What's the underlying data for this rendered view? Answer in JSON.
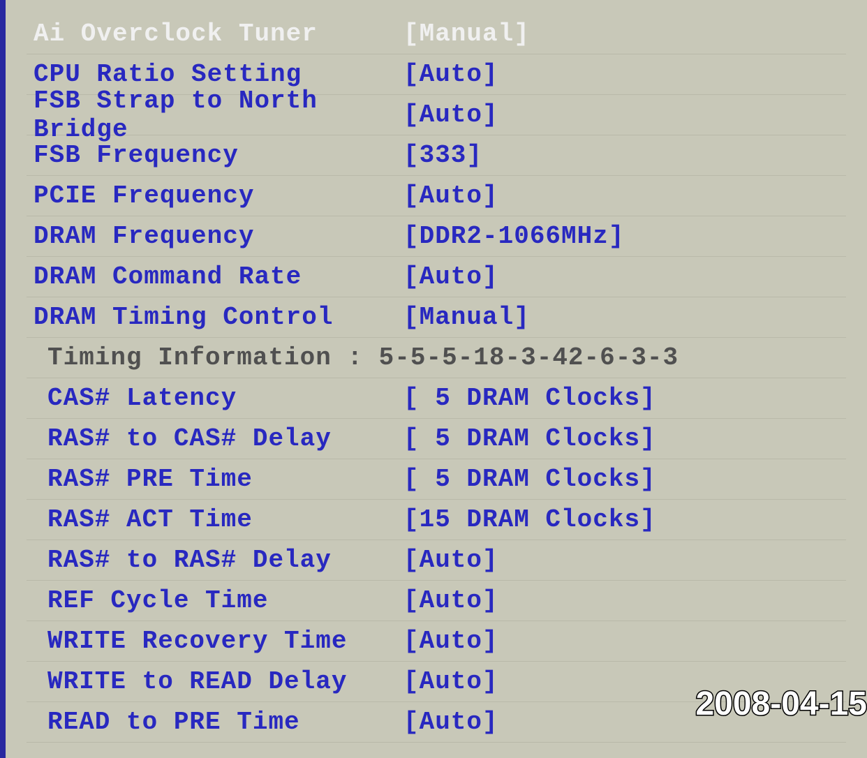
{
  "rows": [
    {
      "label": "Ai Overclock Tuner",
      "value": "[Manual]",
      "selected": true
    },
    {
      "label": "CPU Ratio Setting",
      "value": "[Auto]"
    },
    {
      "label": "FSB Strap to North Bridge",
      "value": "[Auto]"
    },
    {
      "label": "FSB Frequency",
      "value": "[333]"
    },
    {
      "label": "PCIE Frequency",
      "value": "[Auto]"
    },
    {
      "label": "DRAM Frequency",
      "value": "[DDR2-1066MHz]"
    },
    {
      "label": "DRAM Command Rate",
      "value": "[Auto]"
    },
    {
      "label": "DRAM Timing Control",
      "value": "[Manual]"
    }
  ],
  "info_line": "Timing Information : 5-5-5-18-3-42-6-3-3",
  "subrows": [
    {
      "label": "CAS# Latency",
      "value": "[ 5 DRAM Clocks]"
    },
    {
      "label": "RAS# to CAS# Delay",
      "value": "[ 5 DRAM Clocks]"
    },
    {
      "label": "RAS# PRE Time",
      "value": "[ 5 DRAM Clocks]"
    },
    {
      "label": "RAS# ACT Time",
      "value": "[15 DRAM Clocks]"
    },
    {
      "label": "RAS# to RAS# Delay",
      "value": "[Auto]"
    },
    {
      "label": "REF Cycle Time",
      "value": "[Auto]"
    },
    {
      "label": "WRITE Recovery Time",
      "value": "[Auto]"
    },
    {
      "label": "WRITE to READ Delay",
      "value": "[Auto]"
    },
    {
      "label": "READ to PRE Time",
      "value": "[Auto]"
    }
  ],
  "timestamp": "2008-04-15"
}
